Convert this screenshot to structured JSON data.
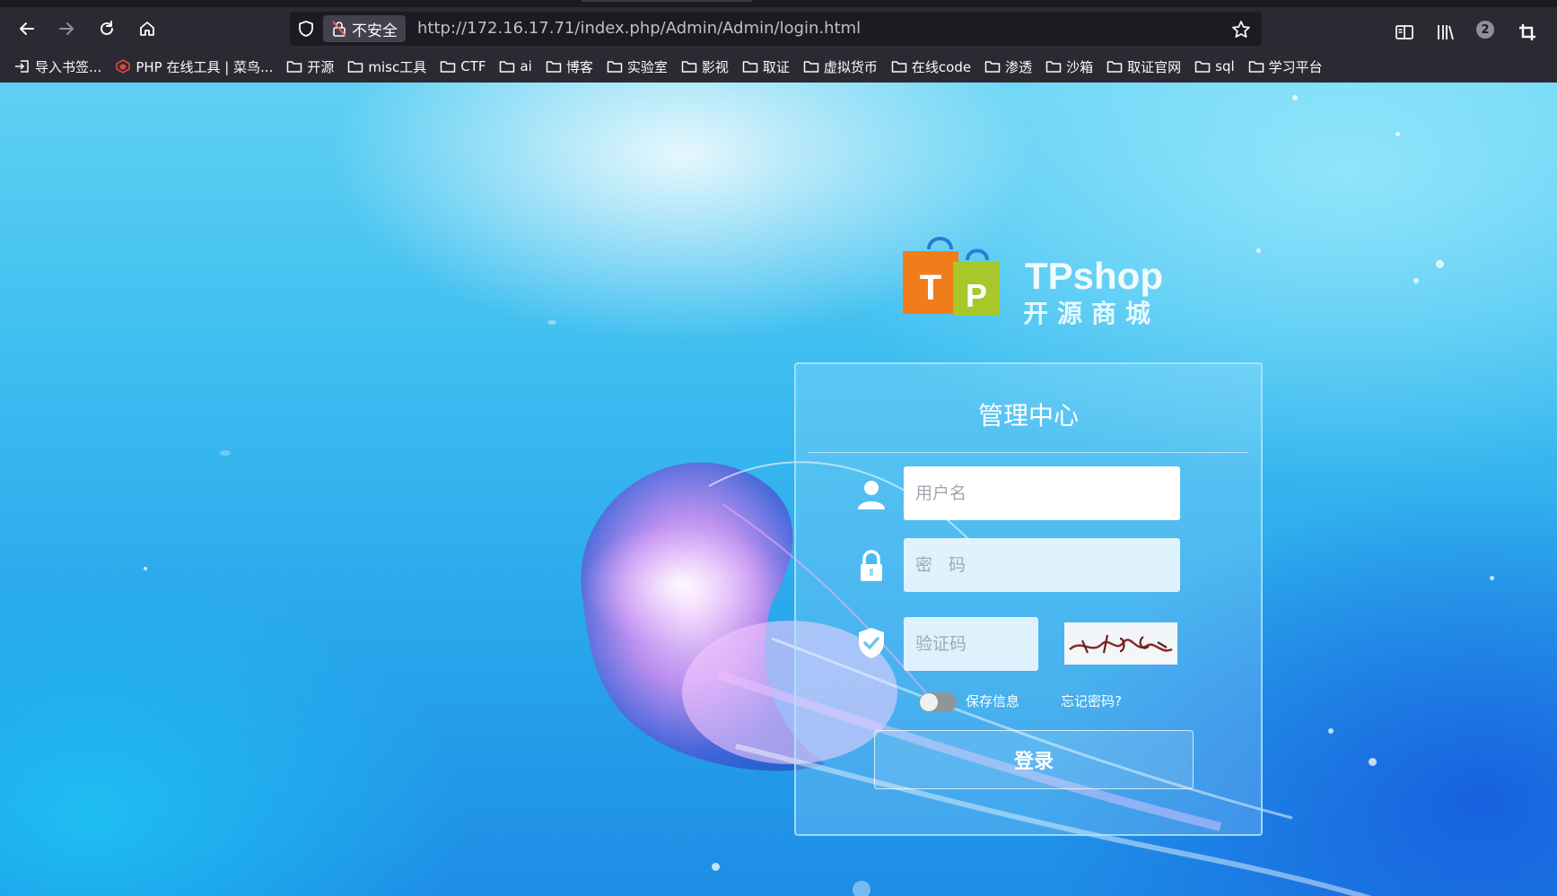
{
  "browser": {
    "security_label": "不安全",
    "url": "http://172.16.17.71/index.php/Admin/Admin/login.html",
    "account_badge": "2",
    "icons": [
      "back-icon",
      "forward-icon",
      "reload-icon",
      "home-icon",
      "shield-icon",
      "lock-warning-icon",
      "star-icon",
      "reader-view-icon",
      "library-icon",
      "account-icon",
      "extension-icon"
    ]
  },
  "bookmarks": [
    {
      "label": "导入书签...",
      "icon": "import-icon"
    },
    {
      "label": "PHP 在线工具 | 菜鸟...",
      "icon": "runoob-icon"
    },
    {
      "label": "开源",
      "icon": "folder-icon"
    },
    {
      "label": "misc工具",
      "icon": "folder-icon"
    },
    {
      "label": "CTF",
      "icon": "folder-icon"
    },
    {
      "label": "ai",
      "icon": "folder-icon"
    },
    {
      "label": "博客",
      "icon": "folder-icon"
    },
    {
      "label": "实验室",
      "icon": "folder-icon"
    },
    {
      "label": "影视",
      "icon": "folder-icon"
    },
    {
      "label": "取证",
      "icon": "folder-icon"
    },
    {
      "label": "虚拟货币",
      "icon": "folder-icon"
    },
    {
      "label": "在线code",
      "icon": "folder-icon"
    },
    {
      "label": "渗透",
      "icon": "folder-icon"
    },
    {
      "label": "沙箱",
      "icon": "folder-icon"
    },
    {
      "label": "取证官网",
      "icon": "folder-icon"
    },
    {
      "label": "sql",
      "icon": "folder-icon"
    },
    {
      "label": "学习平台",
      "icon": "folder-icon"
    }
  ],
  "logo": {
    "name": "TPshop",
    "subtitle": "开源商城",
    "bag_letters": [
      "T",
      "P"
    ]
  },
  "login": {
    "title": "管理中心",
    "username_placeholder": "用户名",
    "password_placeholder": "密 码",
    "captcha_placeholder": "验证码",
    "remember_label": "保存信息",
    "forgot_label": "忘记密码?",
    "submit_label": "登录",
    "icons": [
      "user-icon",
      "lock-icon",
      "shield-check-icon"
    ]
  },
  "colors": {
    "chrome_bg": "#2b2a33",
    "url_bg": "#1c1b22",
    "page_blue": "#2aa8ec",
    "bag_orange": "#f07d1a",
    "bag_green": "#a9c72a"
  }
}
